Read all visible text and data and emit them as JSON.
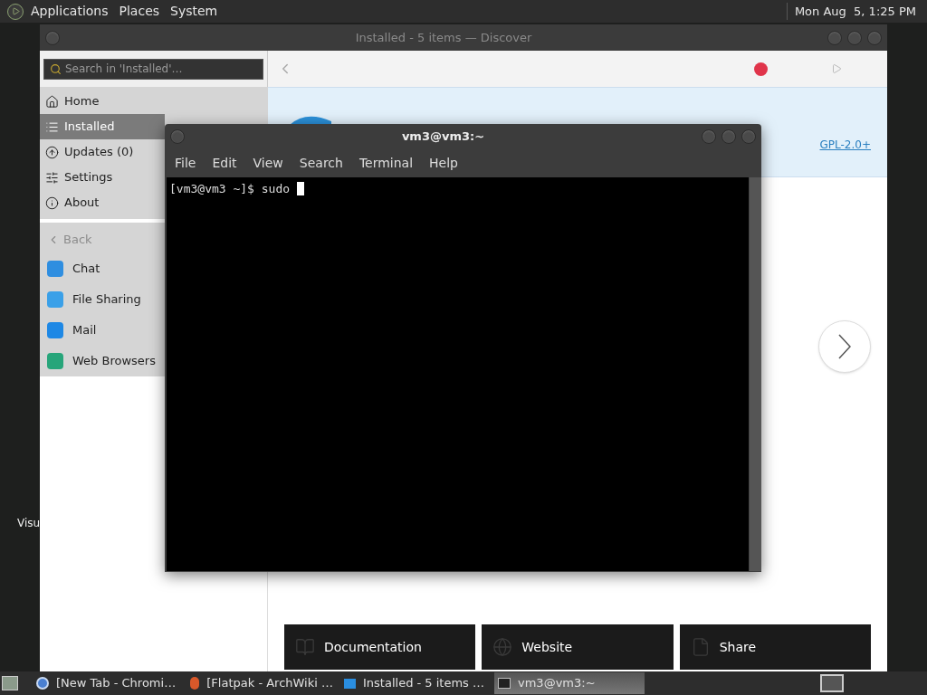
{
  "top_panel": {
    "menus": [
      "Applications",
      "Places",
      "System"
    ],
    "clock": "Mon Aug  5, 1:25 PM"
  },
  "desktop": {
    "icon_labels": [
      "Visu"
    ]
  },
  "discover": {
    "title": "Installed - 5 items — Discover",
    "search": {
      "placeholder": "Search in 'Installed'…"
    },
    "nav_items": [
      {
        "label": "Home",
        "kind": "home",
        "selected": false
      },
      {
        "label": "Installed",
        "kind": "list",
        "selected": true
      },
      {
        "label": "Updates (0)",
        "kind": "update",
        "selected": false
      },
      {
        "label": "Settings",
        "kind": "sliders",
        "selected": false
      },
      {
        "label": "About",
        "kind": "info",
        "selected": false
      }
    ],
    "back": {
      "label": "Back",
      "disabled": true
    },
    "categories": [
      {
        "label": "Chat",
        "color": "#2f8ee0"
      },
      {
        "label": "File Sharing",
        "color": "#3aa0e8"
      },
      {
        "label": "Mail",
        "color": "#1e88e5"
      },
      {
        "label": "Web Browsers",
        "color": "#27a57a"
      }
    ],
    "license_link": "GPL-2.0+",
    "bottom_buttons": [
      {
        "label": "Documentation",
        "kind": "book"
      },
      {
        "label": "Website",
        "kind": "globe"
      },
      {
        "label": "Share",
        "kind": "file"
      }
    ]
  },
  "terminal": {
    "title": "vm3@vm3:~",
    "menu": [
      "File",
      "Edit",
      "View",
      "Search",
      "Terminal",
      "Help"
    ],
    "lines": [
      "[vm3@vm3 ~]$ sudo "
    ]
  },
  "taskbar": {
    "items": [
      {
        "label": "[New Tab - Chromi…",
        "kind": "browser",
        "selected": false
      },
      {
        "label": "[Flatpak - ArchWiki …",
        "kind": "firefox",
        "selected": false
      },
      {
        "label": "Installed - 5 items …",
        "kind": "app",
        "selected": false
      },
      {
        "label": "vm3@vm3:~",
        "kind": "terminal",
        "selected": true
      }
    ]
  }
}
